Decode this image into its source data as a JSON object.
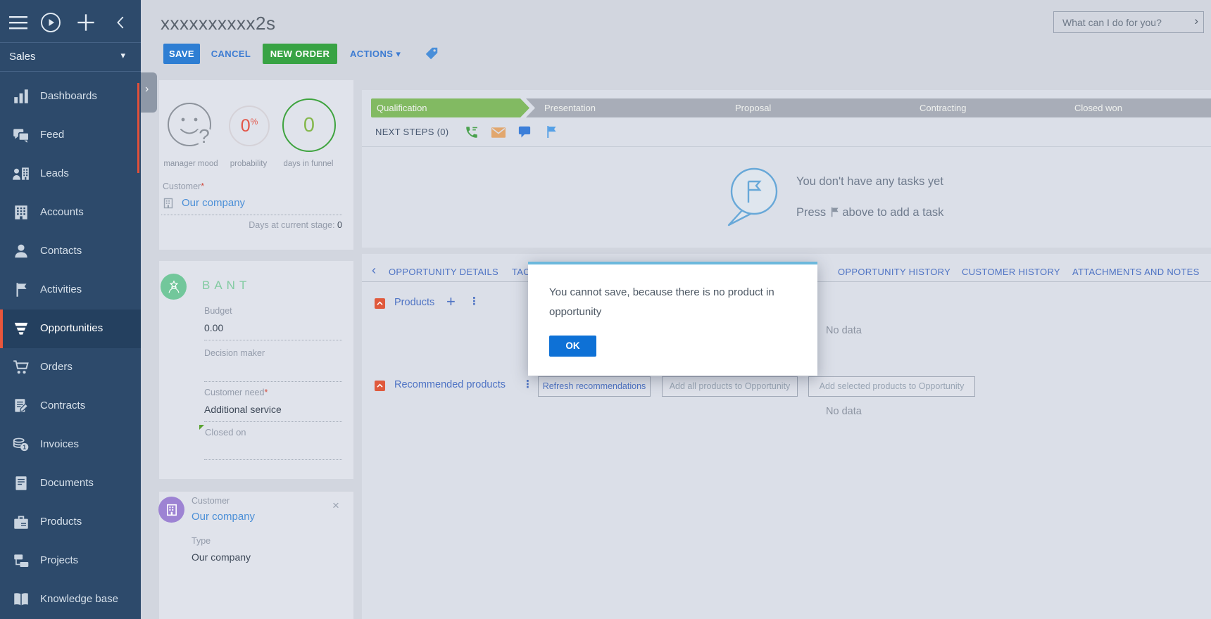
{
  "glyphs": {
    "caret_down": "▾",
    "chevron_right": "›",
    "chevron_left": "‹",
    "plus": "+",
    "kebab": "⋮",
    "close": "×",
    "question": "?"
  },
  "sidebar": {
    "workplace": "Sales",
    "items": [
      {
        "label": "Dashboards"
      },
      {
        "label": "Feed"
      },
      {
        "label": "Leads"
      },
      {
        "label": "Accounts"
      },
      {
        "label": "Contacts"
      },
      {
        "label": "Activities"
      },
      {
        "label": "Opportunities",
        "selected": true
      },
      {
        "label": "Orders"
      },
      {
        "label": "Contracts"
      },
      {
        "label": "Invoices"
      },
      {
        "label": "Documents"
      },
      {
        "label": "Products"
      },
      {
        "label": "Projects"
      },
      {
        "label": "Knowledge base"
      }
    ]
  },
  "header": {
    "title": "xxxxxxxxxx2s",
    "save_label": "SAVE",
    "cancel_label": "CANCEL",
    "new_order_label": "NEW ORDER",
    "actions_label": "ACTIONS",
    "assistant_placeholder": "What can I do for you?"
  },
  "indicators": {
    "mood_label": "manager mood",
    "probability_value": "0",
    "probability_unit": "%",
    "probability_label": "probability",
    "days_in_funnel_value": "0",
    "days_in_funnel_label": "days in funnel",
    "customer_label": "Customer",
    "required_marker": "*",
    "customer_value": "Our company",
    "days_at_stage_label": "Days at current stage:",
    "days_at_stage_value": "0"
  },
  "bant": {
    "title": "BANT",
    "budget_label": "Budget",
    "budget_value": "0.00",
    "decision_maker_label": "Decision maker",
    "customer_need_label": "Customer need",
    "required_marker": "*",
    "customer_need_value": "Additional service",
    "closed_on_label": "Closed on"
  },
  "customer_card": {
    "customer_label": "Customer",
    "customer_value": "Our company",
    "type_label": "Type",
    "type_value": "Our company"
  },
  "funnel": {
    "stages": [
      {
        "label": "Qualification",
        "state": "active"
      },
      {
        "label": "Presentation",
        "state": "pending"
      },
      {
        "label": "Proposal",
        "state": "pending"
      },
      {
        "label": "Contracting",
        "state": "pending"
      },
      {
        "label": "Closed won",
        "state": "pending"
      }
    ]
  },
  "next_steps": {
    "title": "NEXT STEPS (0)"
  },
  "tasks_empty": {
    "line1": "You don't have any tasks yet",
    "line2_before": "Press",
    "line2_after": "above to add a task"
  },
  "tabs": [
    {
      "label": "OPPORTUNITY DETAILS"
    },
    {
      "label": "TAC"
    },
    {
      "label": "OPPORTUNITY HISTORY"
    },
    {
      "label": "CUSTOMER HISTORY"
    },
    {
      "label": "ATTACHMENTS AND NOTES"
    }
  ],
  "details": {
    "products_title": "Products",
    "products_no_data": "No data",
    "recommended_title": "Recommended products",
    "refresh_button": "Refresh recommendations",
    "add_all_button": "Add all products to Opportunity",
    "add_selected_button": "Add selected products to Opportunity",
    "recommended_no_data": "No data"
  },
  "dialog": {
    "message": "You cannot save, because there is no product in opportunity",
    "ok_label": "OK"
  },
  "colors": {
    "sidebar_bg": "#2d4a6b",
    "selected_marker": "#e8563c",
    "accent_blue": "#2e7ed3",
    "accent_green": "#38a344",
    "funnel_active": "#82ba62",
    "funnel_pending": "#a8adb8",
    "alert_bar": "#6cb8dc",
    "ok_button": "#0e71d6",
    "link": "#4b8fd7",
    "section_marker": "#e05a3d"
  }
}
